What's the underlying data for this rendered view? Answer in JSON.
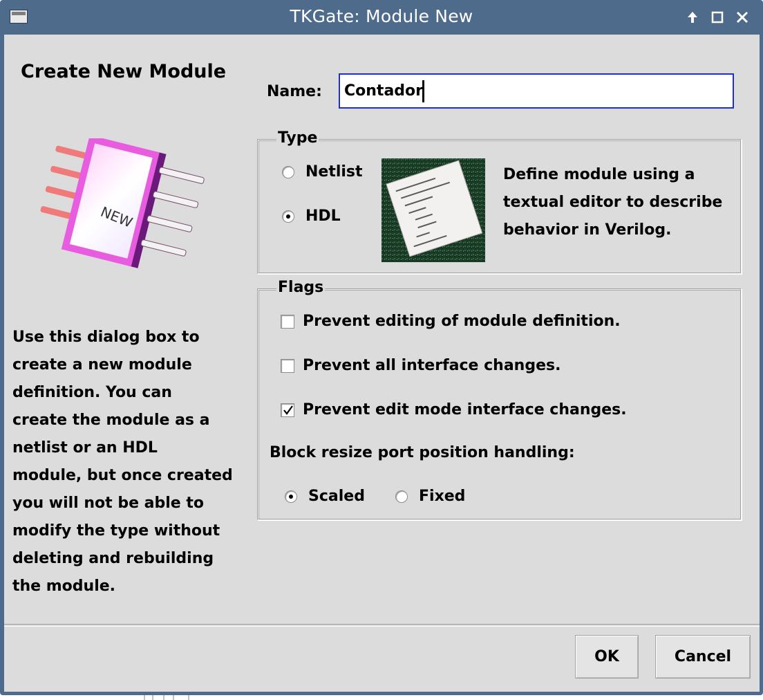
{
  "window": {
    "title": "TKGate: Module New",
    "title_buttons": [
      "keep-above-icon",
      "maximize-icon",
      "close-icon"
    ]
  },
  "left": {
    "heading": "Create New Module",
    "chip_label": "NEW",
    "description": "Use this dialog box to\ncreate a new module\ndefinition.  You can\ncreate the module as a\nnetlist or an HDL\nmodule, but once created\nyou will not be able to\nmodify the type without\ndeleting and rebuilding\nthe module."
  },
  "name": {
    "label": "Name:",
    "value": "Contador"
  },
  "type": {
    "title": "Type",
    "options": [
      {
        "label": "Netlist",
        "selected": false
      },
      {
        "label": "HDL",
        "selected": true
      }
    ],
    "description": "Define module using a\ntextual editor to describe\nbehavior in Verilog."
  },
  "flags": {
    "title": "Flags",
    "checks": [
      {
        "label": "Prevent editing of module definition.",
        "checked": false
      },
      {
        "label": "Prevent all interface changes.",
        "checked": false
      },
      {
        "label": "Prevent edit mode interface changes.",
        "checked": true
      }
    ],
    "resize_label": "Block resize port position handling:",
    "resize_options": [
      {
        "label": "Scaled",
        "selected": true
      },
      {
        "label": "Fixed",
        "selected": false
      }
    ]
  },
  "buttons": {
    "ok": "OK",
    "cancel": "Cancel"
  },
  "colors": {
    "titlebar": "#4f6b8c",
    "dialog_bg": "#dcdcdc",
    "focus_border": "#1c2fd6",
    "chip_magenta": "#e85ce0"
  }
}
